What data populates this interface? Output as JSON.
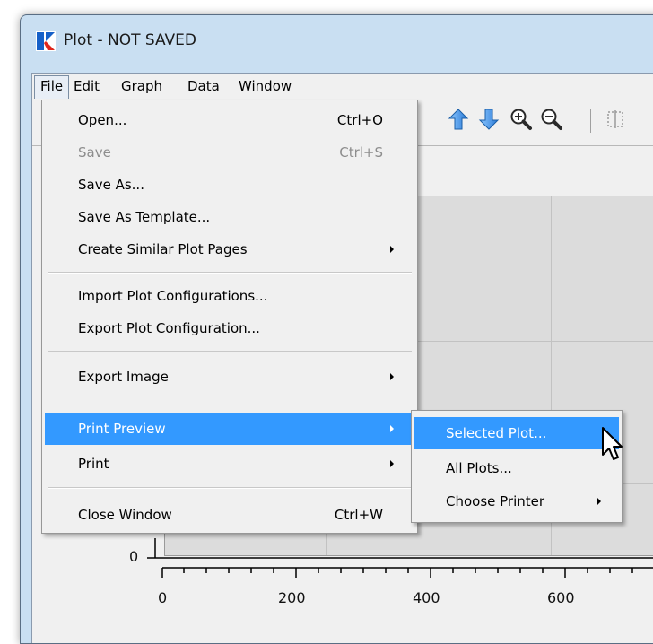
{
  "window": {
    "title": "Plot - NOT SAVED",
    "accent_color": "#3399ff"
  },
  "menubar": {
    "items": [
      "File",
      "Edit",
      "Graph",
      "Data",
      "Window"
    ],
    "open_menu": "File"
  },
  "toolbar": {
    "icons": [
      "arrow-up-icon",
      "arrow-down-icon",
      "zoom-in-icon",
      "zoom-out-icon",
      "split-icon"
    ]
  },
  "file_menu": {
    "items": [
      {
        "label": "Open...",
        "shortcut": "Ctrl+O"
      },
      {
        "label": "Save",
        "shortcut": "Ctrl+S",
        "disabled": true
      },
      {
        "label": "Save As..."
      },
      {
        "label": "Save As Template..."
      },
      {
        "label": "Create Similar Plot Pages",
        "submenu": true
      },
      {
        "label": "Import Plot Configurations..."
      },
      {
        "label": "Export Plot Configuration..."
      },
      {
        "label": "Export Image",
        "submenu": true
      },
      {
        "label": "Print Preview",
        "submenu": true,
        "highlighted": true
      },
      {
        "label": "Print",
        "submenu": true
      },
      {
        "label": "Close Window",
        "shortcut": "Ctrl+W"
      }
    ]
  },
  "print_preview_submenu": {
    "items": [
      {
        "label": "Selected Plot...",
        "highlighted": true
      },
      {
        "label": "All Plots..."
      },
      {
        "label": "Choose Printer",
        "submenu": true
      }
    ]
  },
  "plot": {
    "y_ticks": [
      "0"
    ],
    "x_ticks": [
      "0",
      "200",
      "400",
      "600"
    ]
  }
}
